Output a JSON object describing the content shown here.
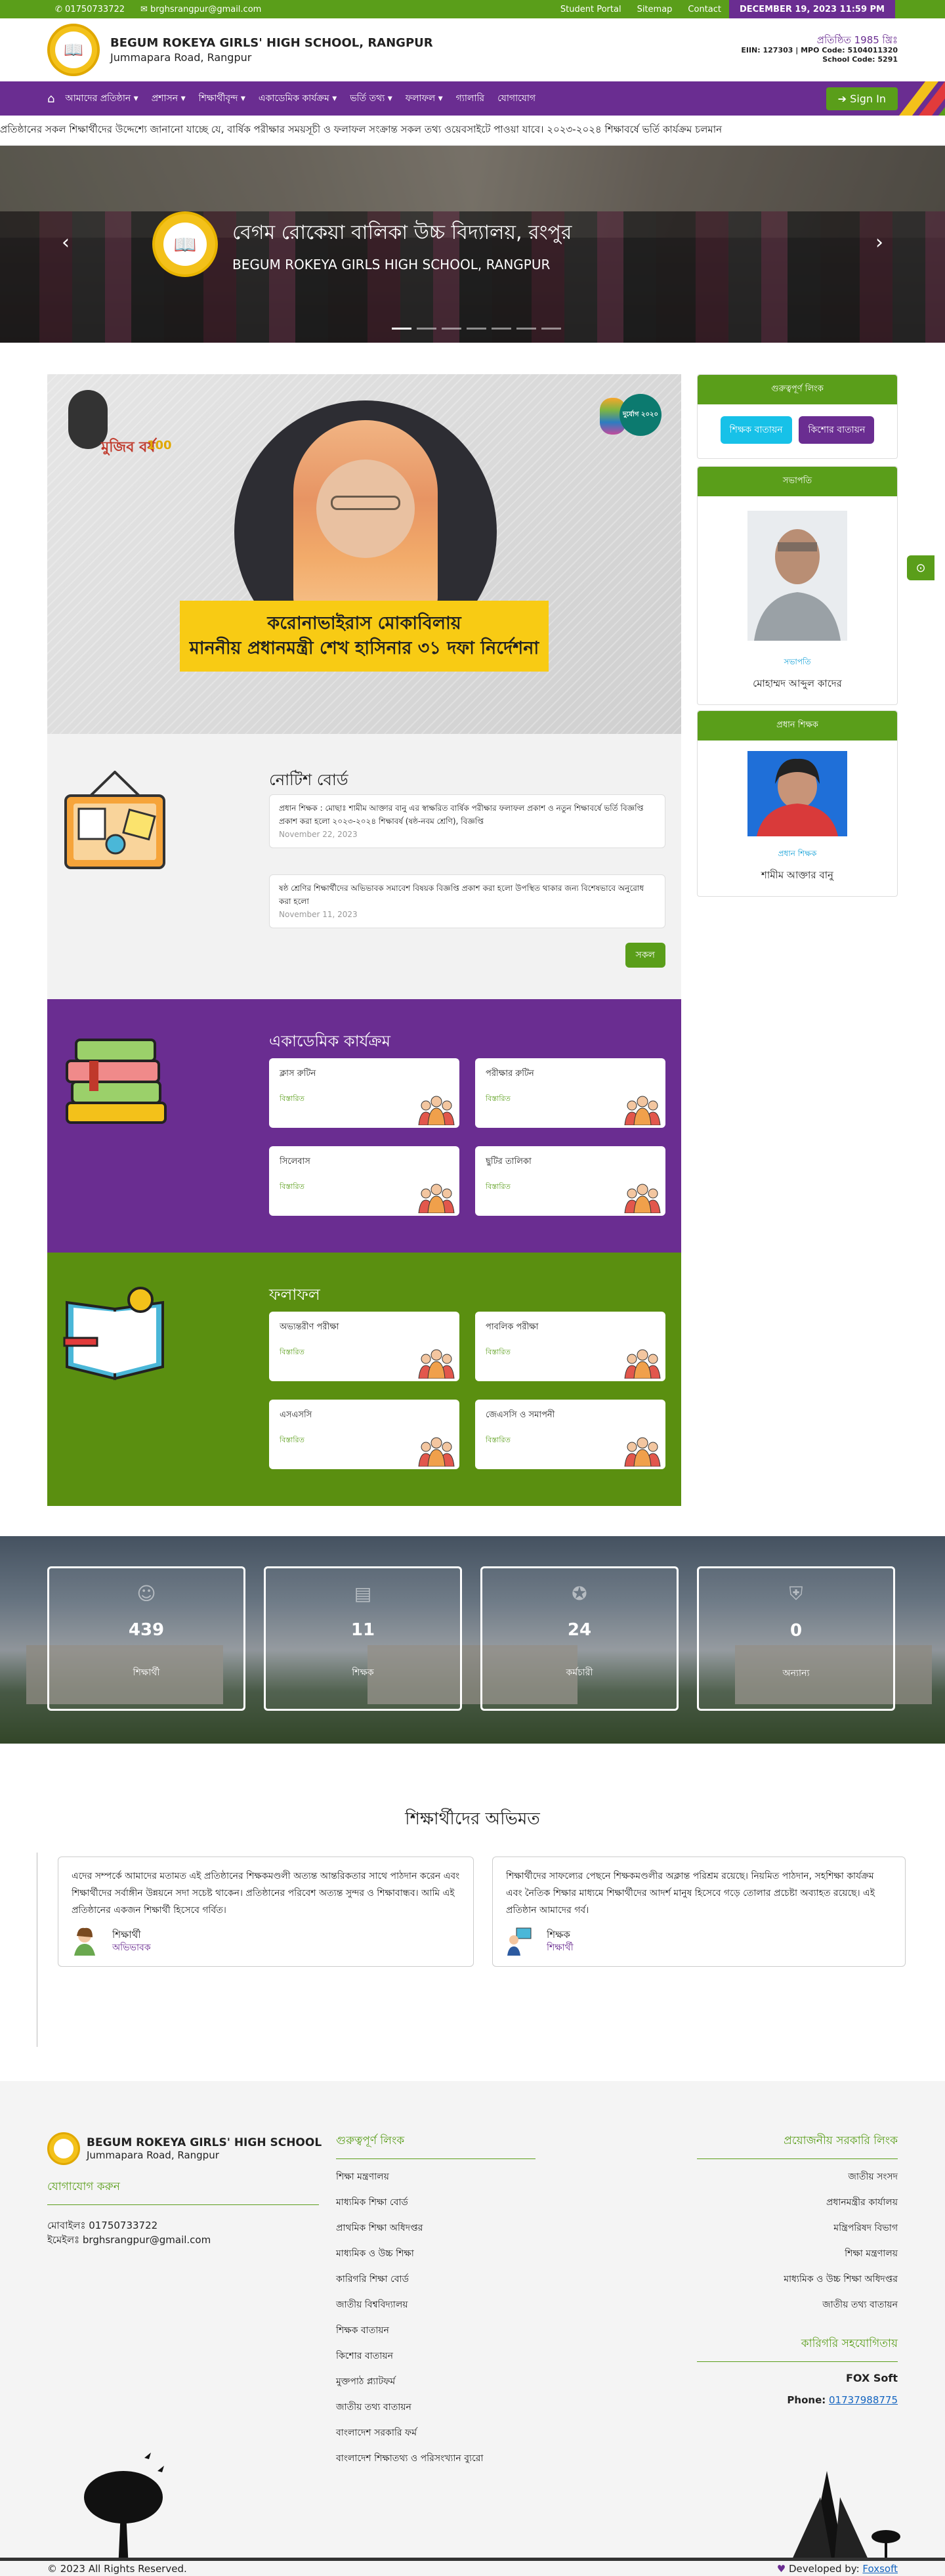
{
  "topbar": {
    "phone": "01750733722",
    "email": "brghsrangpur@gmail.com",
    "links": [
      "Student Portal",
      "Sitemap",
      "Contact"
    ],
    "datetime": "DECEMBER 19, 2023 11:59 PM"
  },
  "header": {
    "name": "BEGUM ROKEYA GIRLS' HIGH SCHOOL, RANGPUR",
    "address": "Jummapara Road, Rangpur",
    "established": "প্রতিষ্ঠিত 1985 খ্রিঃ",
    "eiin": "EIIN: 127303 | MPO Code: 5104011320",
    "school_code": "School Code: 5291"
  },
  "nav": {
    "items": [
      "আমাদের প্রতিষ্ঠান",
      "প্রশাসন",
      "শিক্ষার্থীবৃন্দ",
      "একাডেমিক কার্যক্রম",
      "ভর্তি তথ্য",
      "ফলাফল",
      "গ্যালারি",
      "যোগাযোগ"
    ],
    "signin": "Sign In"
  },
  "marquee": "প্রতিষ্ঠানের সকল শিক্ষার্থীদের উদ্দেশ্যে জানানো যাচ্ছে যে, বার্ষিক পরীক্ষার সময়সূচী ও ফলাফল সংক্রান্ত সকল তথ্য ওয়েবসাইটে পাওয়া যাবে। ২০২৩-২০২৪ শিক্ষাবর্ষে ভর্তি কার্যক্রম চলমান",
  "hero": {
    "title": "বেগম রোকেয়া বালিকা উচ্চ বিদ্যালয়, রংপুর",
    "subtitle": "BEGUM ROKEYA GIRLS HIGH SCHOOL, RANGPUR",
    "slides": 7,
    "active_slide": 1
  },
  "banner": {
    "line1": "করোনাভাইরাস মোকাবিলায়",
    "line2": "মাননীয় প্রধানমন্ত্রী শেখ হাসিনার ৩১ দফা নির্দেশনা",
    "mujib_text": "মুজিব বর্ষ",
    "mujib_num": "100",
    "badge": "দুর্যোগ ২০২০"
  },
  "notice": {
    "title": "নোটিশ বোর্ড",
    "items": [
      {
        "text": "প্রধান শিক্ষক : মোছাঃ শামীম আক্তার বানু এর স্বাক্ষরিত বার্ষিক পরীক্ষার ফলাফল প্রকাশ ও নতুন শিক্ষাবর্ষে ভর্তি বিজ্ঞপ্তি প্রকাশ করা হলো ২০২৩-২০২৪ শিক্ষাবর্ষ (ষষ্ঠ-নবম শ্রেণি), বিজ্ঞপ্তি",
        "date": "November 22, 2023"
      },
      {
        "text": "ষষ্ঠ শ্রেণির শিক্ষার্থীদের অভিভাবক সমাবেশ বিষয়ক বিজ্ঞপ্তি প্রকাশ করা হলো উপস্থিত থাকার জন্য বিশেষভাবে অনুরোধ করা হলো",
        "date": "November 11, 2023"
      }
    ],
    "all_label": "সকল"
  },
  "academic": {
    "title": "একাডেমিক কার্যক্রম",
    "cards": [
      {
        "title": "ক্লাস রুটিন",
        "sub": "বিস্তারিত"
      },
      {
        "title": "পরীক্ষার রুটিন",
        "sub": "বিস্তারিত"
      },
      {
        "title": "সিলেবাস",
        "sub": "বিস্তারিত"
      },
      {
        "title": "ছুটির তালিকা",
        "sub": "বিস্তারিত"
      }
    ]
  },
  "results": {
    "title": "ফলাফল",
    "cards": [
      {
        "title": "অভ্যন্তরীণ পরীক্ষা",
        "sub": "বিস্তারিত"
      },
      {
        "title": "পাবলিক পরীক্ষা",
        "sub": "বিস্তারিত"
      },
      {
        "title": "এসএসসি",
        "sub": "বিস্তারিত"
      },
      {
        "title": "জেএসসি ও সমাপনী",
        "sub": "বিস্তারিত"
      }
    ]
  },
  "sidebar": {
    "links_title": "গুরুত্বপূর্ণ লিংক",
    "btn1": "শিক্ষক বাতায়ন",
    "btn2": "কিশোর বাতায়ন",
    "chairman_title": "সভাপতি",
    "chairman_role": "সভাপতি",
    "chairman_name": "মোহাম্মদ আব্দুল কাদের",
    "head_title": "প্রধান শিক্ষক",
    "head_role": "প্রধান শিক্ষক",
    "head_name": "শামীম আক্তার বানু"
  },
  "stats": [
    {
      "value": "439",
      "label": "শিক্ষার্থী",
      "icon": "smile-icon"
    },
    {
      "value": "11",
      "label": "শিক্ষক",
      "icon": "book-icon"
    },
    {
      "value": "24",
      "label": "কর্মচারী",
      "icon": "award-icon"
    },
    {
      "value": "0",
      "label": "অন্যান্য",
      "icon": "shield-icon"
    }
  ],
  "testimonials": {
    "title": "শিক্ষার্থীদের অভিমত",
    "items": [
      {
        "text": "এদের সম্পর্কে আমাদের মতামত এই প্রতিষ্ঠানের শিক্ষকমণ্ডলী অত্যন্ত আন্তরিকতার সাথে পাঠদান করেন এবং শিক্ষার্থীদের সর্বাঙ্গীন উন্নয়নে সদা সচেষ্ট থাকেন। প্রতিষ্ঠানের পরিবেশ অত্যন্ত সুন্দর ও শিক্ষাবান্ধব। আমি এই প্রতিষ্ঠানের একজন শিক্ষার্থী হিসেবে গর্বিত।",
        "name": "শিক্ষার্থী",
        "role": "অভিভাবক"
      },
      {
        "text": "শিক্ষার্থীদের সাফল্যের পেছনে শিক্ষকমণ্ডলীর অক্লান্ত পরিশ্রম রয়েছে। নিয়মিত পাঠদান, সহশিক্ষা কার্যক্রম এবং নৈতিক শিক্ষার মাধ্যমে শিক্ষার্থীদের আদর্শ মানুষ হিসেবে গড়ে তোলার প্রচেষ্টা অব্যাহত রয়েছে। এই প্রতিষ্ঠান আমাদের গর্ব।",
        "name": "শিক্ষক",
        "role": "শিক্ষার্থী"
      }
    ]
  },
  "footer": {
    "name": "BEGUM ROKEYA GIRLS' HIGH SCHOOL",
    "address": "Jummapara Road, Rangpur",
    "contact_title": "যোগাযোগ করুন",
    "phone": "মোবাইলঃ 01750733722",
    "email": "ইমেইলঃ brghsrangpur@gmail.com",
    "links_title": "গুরুত্বপূর্ণ লিংক",
    "links": [
      "শিক্ষা মন্ত্রণালয়",
      "মাধ্যমিক শিক্ষা বোর্ড",
      "প্রাথমিক শিক্ষা অধিদপ্তর",
      "মাধ্যমিক ও উচ্চ শিক্ষা",
      "কারিগরি শিক্ষা বোর্ড",
      "জাতীয় বিশ্ববিদ্যালয়",
      "শিক্ষক বাতায়ন",
      "কিশোর বাতায়ন",
      "মুক্তপাঠ প্ল্যাটফর্ম",
      "জাতীয় তথ্য বাতায়ন",
      "বাংলাদেশ সরকারি ফর্ম",
      "বাংলাদেশ শিক্ষাতথ্য ও পরিসংখ্যান ব্যুরো"
    ],
    "govt_title": "প্রয়োজনীয় সরকারি লিংক",
    "govt_links": [
      "জাতীয় সংসদ",
      "প্রধানমন্ত্রীর কার্যালয়",
      "মন্ত্রিপরিষদ বিভাগ",
      "শিক্ষা মন্ত্রণালয়",
      "মাধ্যমিক ও উচ্চ শিক্ষা অধিদপ্তর",
      "জাতীয় তথ্য বাতায়ন"
    ],
    "tech_title": "কারিগরি সহযোগিতায়",
    "tech_name": "FOX Soft",
    "tech_phone_label": "Phone:",
    "tech_phone": "01737988775",
    "copyright": "© 2023 All Rights Reserved.",
    "dev_label": "Developed by:",
    "dev_link": "Foxsoft"
  }
}
